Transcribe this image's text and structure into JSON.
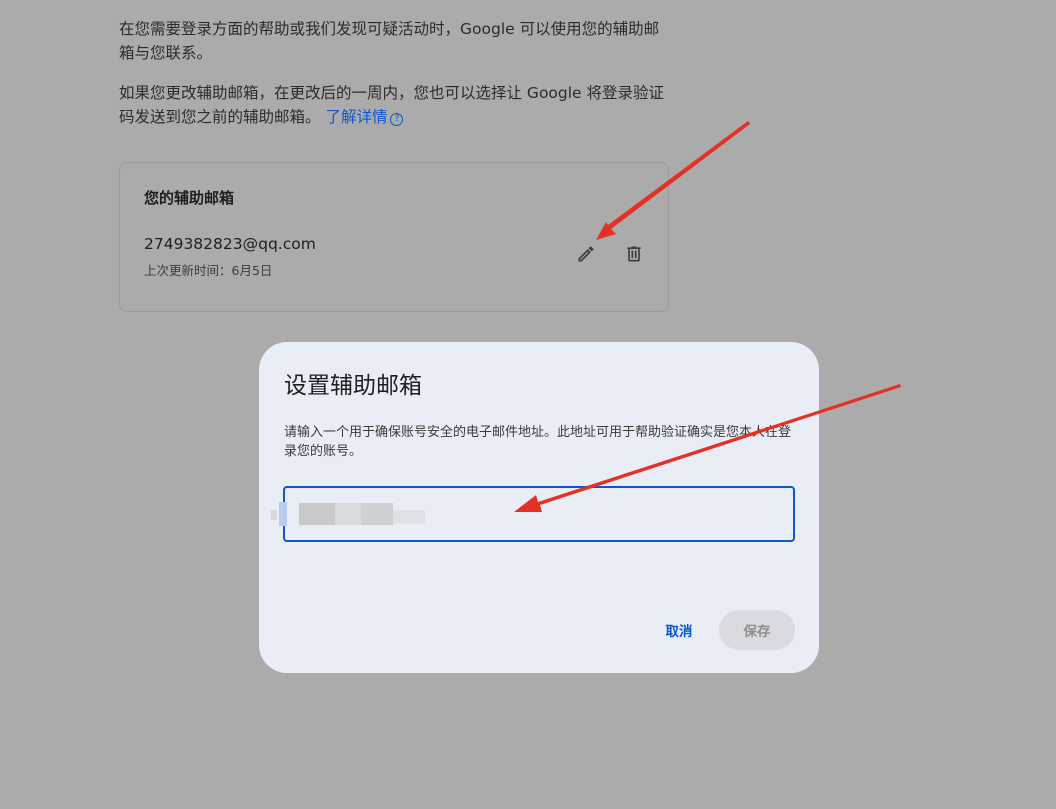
{
  "background": {
    "paragraph1": "在您需要登录方面的帮助或我们发现可疑活动时，Google 可以使用您的辅助邮箱与您联系。",
    "paragraph2": "如果您更改辅助邮箱，在更改后的一周内，您也可以选择让 Google 将登录验证码发送到您之前的辅助邮箱。",
    "learn_more": "了解详情",
    "help_glyph": "?"
  },
  "recovery_card": {
    "title": "您的辅助邮箱",
    "email": "2749382823@qq.com",
    "updated": "上次更新时间：6月5日",
    "edit_icon": "pencil-icon",
    "delete_icon": "trash-icon"
  },
  "dialog": {
    "title": "设置辅助邮箱",
    "description": "请输入一个用于确保账号安全的电子邮件地址。此地址可用于帮助验证确实是您本人在登录您的账号。",
    "input_value": "········@qq.com",
    "cancel_label": "取消",
    "save_label": "保存"
  },
  "colors": {
    "overlay": "#ababab",
    "dialog_bg": "#e9edf5",
    "accent": "#0b57d0",
    "annotation_arrow": "#e53026"
  }
}
